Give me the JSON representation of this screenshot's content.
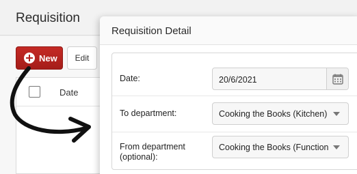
{
  "page": {
    "title": "Requisition",
    "new_label": "New",
    "edit_label": "Edit",
    "table": {
      "columns": [
        "Date"
      ]
    }
  },
  "modal": {
    "title": "Requisition Detail",
    "fields": {
      "date": {
        "label": "Date:",
        "value": "20/6/2021"
      },
      "to_department": {
        "label": "To department:",
        "value": "Cooking the Books (Kitchen)"
      },
      "from_department": {
        "label_line1": "From department",
        "label_line2": "(optional):",
        "value": "Cooking the Books (Function"
      }
    }
  },
  "colors": {
    "accent": "#b3211d",
    "arrow": "#111111"
  },
  "icons": {
    "new": "plus-circle-icon",
    "calendar": "calendar-icon",
    "dropdown": "caret-down-icon",
    "annotation": "curved-arrow-icon"
  }
}
